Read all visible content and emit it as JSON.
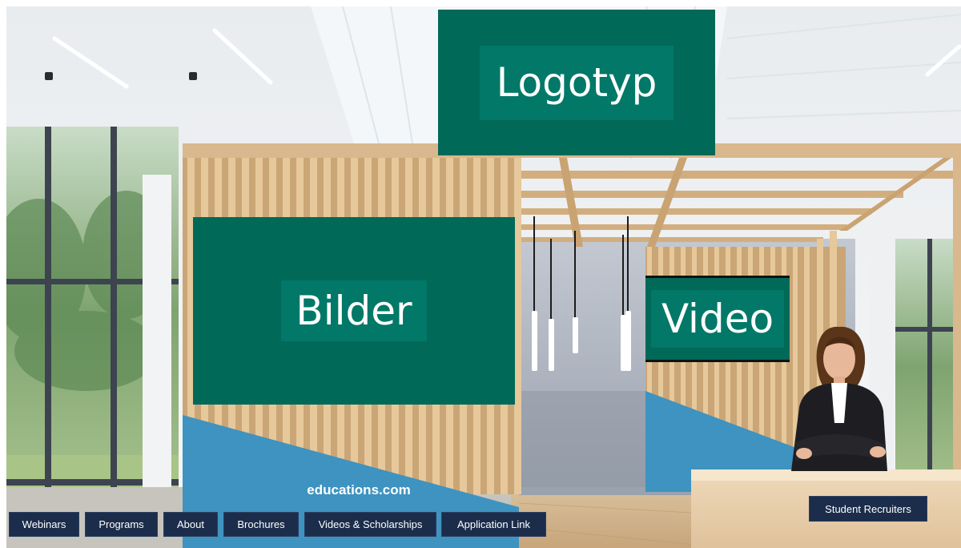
{
  "booth": {
    "logo_panel": "Logotyp",
    "images_panel": "Bilder",
    "video_panel": "Video",
    "banner_text": "educations.com",
    "recruiters_button": "Student Recruiters"
  },
  "nav": {
    "buttons": [
      "Webinars",
      "Programs",
      "About",
      "Brochures",
      "Videos & Scholarships",
      "Application Link"
    ]
  },
  "colors": {
    "panel_green": "#016958",
    "label_green": "#017868",
    "booth_blue": "#3e93c0",
    "button_navy": "#1b2d4a",
    "wood": "#d8b88c"
  }
}
